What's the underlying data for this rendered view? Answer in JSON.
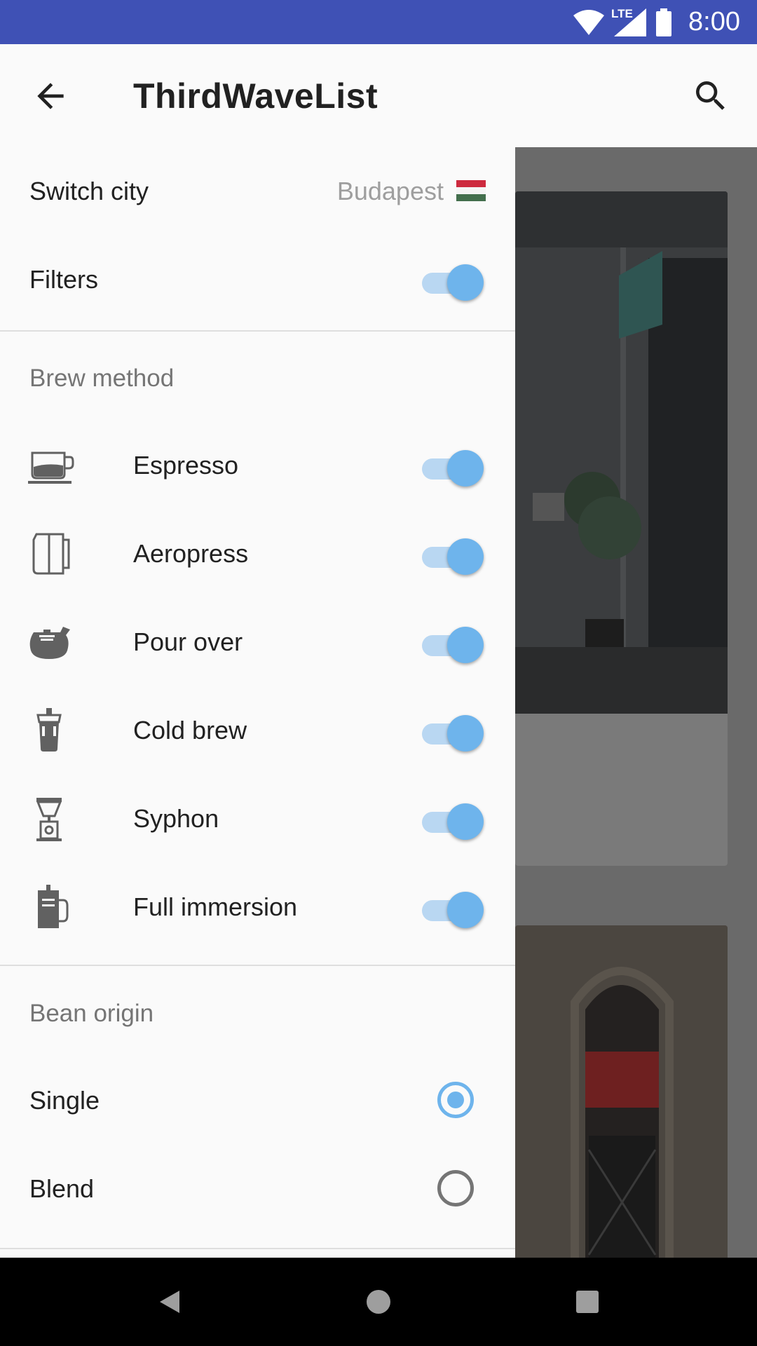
{
  "status_bar": {
    "time": "8:00",
    "network": "LTE",
    "icons": [
      "wifi-icon",
      "cell-signal-icon",
      "battery-icon"
    ]
  },
  "app_bar": {
    "title": "ThirdWaveList",
    "icons": [
      "back-arrow-icon",
      "search-icon"
    ]
  },
  "drawer": {
    "switch_city": {
      "label": "Switch city",
      "value": "Budapest",
      "flag": "hungary-flag-icon"
    },
    "filters": {
      "label": "Filters",
      "enabled": true
    },
    "brew_method": {
      "heading": "Brew method",
      "items": [
        {
          "label": "Espresso",
          "icon": "espresso-cup-icon",
          "enabled": true
        },
        {
          "label": "Aeropress",
          "icon": "aeropress-icon",
          "enabled": true
        },
        {
          "label": "Pour over",
          "icon": "pour-over-icon",
          "enabled": true
        },
        {
          "label": "Cold brew",
          "icon": "cold-brew-icon",
          "enabled": true
        },
        {
          "label": "Syphon",
          "icon": "syphon-icon",
          "enabled": true
        },
        {
          "label": "Full immersion",
          "icon": "french-press-icon",
          "enabled": true
        }
      ]
    },
    "bean_origin": {
      "heading": "Bean origin",
      "options": [
        {
          "label": "Single",
          "selected": true
        },
        {
          "label": "Blend",
          "selected": false
        }
      ]
    }
  },
  "colors": {
    "status_bar": "#3f51b5",
    "accent": "#6eb4ec",
    "scrim": "#6a6a6a"
  }
}
